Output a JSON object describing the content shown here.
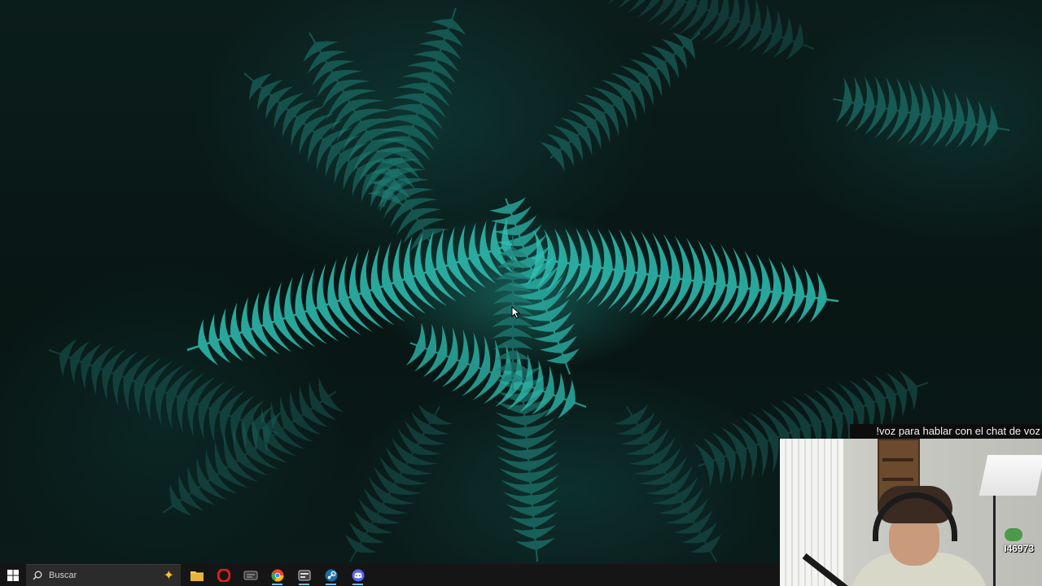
{
  "desktop": {
    "wallpaper": "fern-leaves",
    "accent": "#2fbfb3"
  },
  "stream_overlay": {
    "caption": "!voz para hablar con el chat de voz",
    "counter": "I46973"
  },
  "taskbar": {
    "start_icon": "windows-logo-icon",
    "search_placeholder": "Buscar",
    "apps": [
      {
        "name": "file-explorer",
        "icon": "folder-icon",
        "color": "#f2c94c",
        "active": false
      },
      {
        "name": "opera",
        "icon": "opera-icon",
        "color": "#e0201c",
        "active": false
      },
      {
        "name": "game-app",
        "icon": "game-icon",
        "color": "#9a9a9a",
        "active": false
      },
      {
        "name": "chrome",
        "icon": "chrome-icon",
        "color": "#34a853",
        "active": true
      },
      {
        "name": "media-app",
        "icon": "media-icon",
        "color": "#c9c9c9",
        "active": true
      },
      {
        "name": "steam",
        "icon": "steam-icon",
        "color": "#1b6fa8",
        "active": true
      },
      {
        "name": "discord",
        "icon": "discord-icon",
        "color": "#5865f2",
        "active": true
      }
    ]
  }
}
